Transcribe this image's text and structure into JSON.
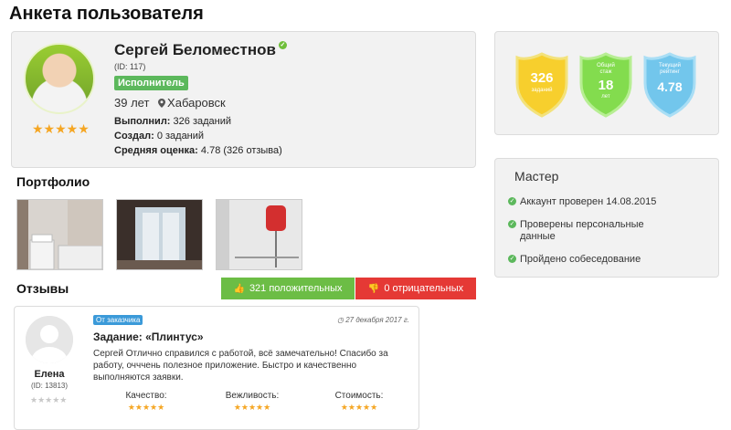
{
  "page": {
    "title": "Анкета пользователя"
  },
  "profile": {
    "name": "Сергей Беломестнов",
    "user_id": "(ID: 117)",
    "role": "Исполнитель",
    "age": "39 лет",
    "city": "Хабаровск",
    "rating_stars": "★★★★★",
    "completed_label": "Выполнил:",
    "completed_value": "326 заданий",
    "created_label": "Создал:",
    "created_value": "0 заданий",
    "avg_label": "Средняя оценка:",
    "avg_value": "4.78 (326 отзыва)"
  },
  "badges": [
    {
      "value": "326",
      "caption": "заданий",
      "color": "#f5c518"
    },
    {
      "caption_top": "Общий стаж",
      "value": "18",
      "caption": "лет",
      "color": "#7bd84a"
    },
    {
      "caption_top": "Текущий рейтинг",
      "value": "4.78",
      "color": "#6ec1e8"
    }
  ],
  "master": {
    "title": "Мастер",
    "items": [
      "Аккаунт проверен 14.08.2015",
      "Проверены персональные данные",
      "Пройдено собеседование"
    ]
  },
  "portfolio": {
    "title": "Портфолио"
  },
  "reviews": {
    "title": "Отзывы",
    "positive": "321 положительных",
    "negative": "0 отрицательных",
    "colors": {
      "positive": "#6cbd45",
      "negative": "#e53935"
    }
  },
  "review": {
    "reviewer_name": "Елена",
    "reviewer_id": "(ID: 13813)",
    "reviewer_stars": "★★★★★",
    "badge": "От заказчика",
    "date": "27 декабря 2017 г.",
    "task": "Задание: «Плинтус»",
    "text": "Сергей Отлично справился с работой, всё замечательно! Спасибо за работу, очччень полезное приложение. Быстро и качественно выполняются заявки.",
    "criteria": [
      {
        "label": "Качество:",
        "stars": "★★★★★"
      },
      {
        "label": "Вежливость:",
        "stars": "★★★★★"
      },
      {
        "label": "Стоимость:",
        "stars": "★★★★★"
      }
    ]
  }
}
